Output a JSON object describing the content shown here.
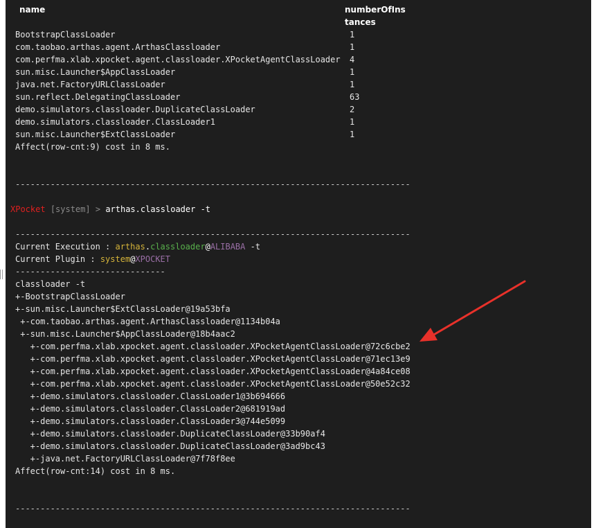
{
  "table": {
    "header_name": "name",
    "header_instances_line1": "numberOfIns",
    "header_instances_line2": "tances",
    "rows": [
      {
        "name": "BootstrapClassLoader",
        "count": "1"
      },
      {
        "name": "com.taobao.arthas.agent.ArthasClassloader",
        "count": "1"
      },
      {
        "name": "com.perfma.xlab.xpocket.agent.classloader.XPocketAgentClassLoader",
        "count": "4"
      },
      {
        "name": "sun.misc.Launcher$AppClassLoader",
        "count": "1"
      },
      {
        "name": "java.net.FactoryURLClassLoader",
        "count": "1"
      },
      {
        "name": "sun.reflect.DelegatingClassLoader",
        "count": "63"
      },
      {
        "name": "demo.simulators.classloader.DuplicateClassLoader",
        "count": "2"
      },
      {
        "name": "demo.simulators.classloader.ClassLoader1",
        "count": "1"
      },
      {
        "name": "sun.misc.Launcher$ExtClassLoader",
        "count": "1"
      }
    ],
    "affect": "Affect(row-cnt:9) cost in 8 ms."
  },
  "separator_long": "-------------------------------------------------------------------------------",
  "separator_short": "------------------------------",
  "prompt": {
    "app": "XPocket",
    "context": "[system]",
    "arrow": ">",
    "command": "arthas.classloader -t"
  },
  "execution": {
    "label": "Current Execution : ",
    "ns": "arthas",
    "dot": ".",
    "cmd": "classloader",
    "at": "@",
    "vendor": "ALIBABA",
    "args": " -t"
  },
  "plugin": {
    "label": "Current Plugin : ",
    "name": "system",
    "at": "@",
    "vendor": "XPOCKET"
  },
  "tree": {
    "command": "classloader -t",
    "lines": [
      "+-BootstrapClassLoader",
      "+-sun.misc.Launcher$ExtClassLoader@19a53bfa",
      " +-com.taobao.arthas.agent.ArthasClassloader@1134b04a",
      " +-sun.misc.Launcher$AppClassLoader@18b4aac2",
      "   +-com.perfma.xlab.xpocket.agent.classloader.XPocketAgentClassLoader@72c6cbe2",
      "   +-com.perfma.xlab.xpocket.agent.classloader.XPocketAgentClassLoader@71ec13e9",
      "   +-com.perfma.xlab.xpocket.agent.classloader.XPocketAgentClassLoader@4a84ce08",
      "   +-com.perfma.xlab.xpocket.agent.classloader.XPocketAgentClassLoader@50e52c32",
      "   +-demo.simulators.classloader.ClassLoader1@3b694666",
      "   +-demo.simulators.classloader.ClassLoader2@681919ad",
      "   +-demo.simulators.classloader.ClassLoader3@744e5099",
      "   +-demo.simulators.classloader.DuplicateClassLoader@33b90af4",
      "   +-demo.simulators.classloader.DuplicateClassLoader@3ad9bc43",
      "   +-java.net.FactoryURLClassLoader@7f78f8ee"
    ],
    "affect": "Affect(row-cnt:14) cost in 8 ms."
  },
  "colors": {
    "background": "#1e1e1e",
    "arrow": "#e8312a"
  }
}
